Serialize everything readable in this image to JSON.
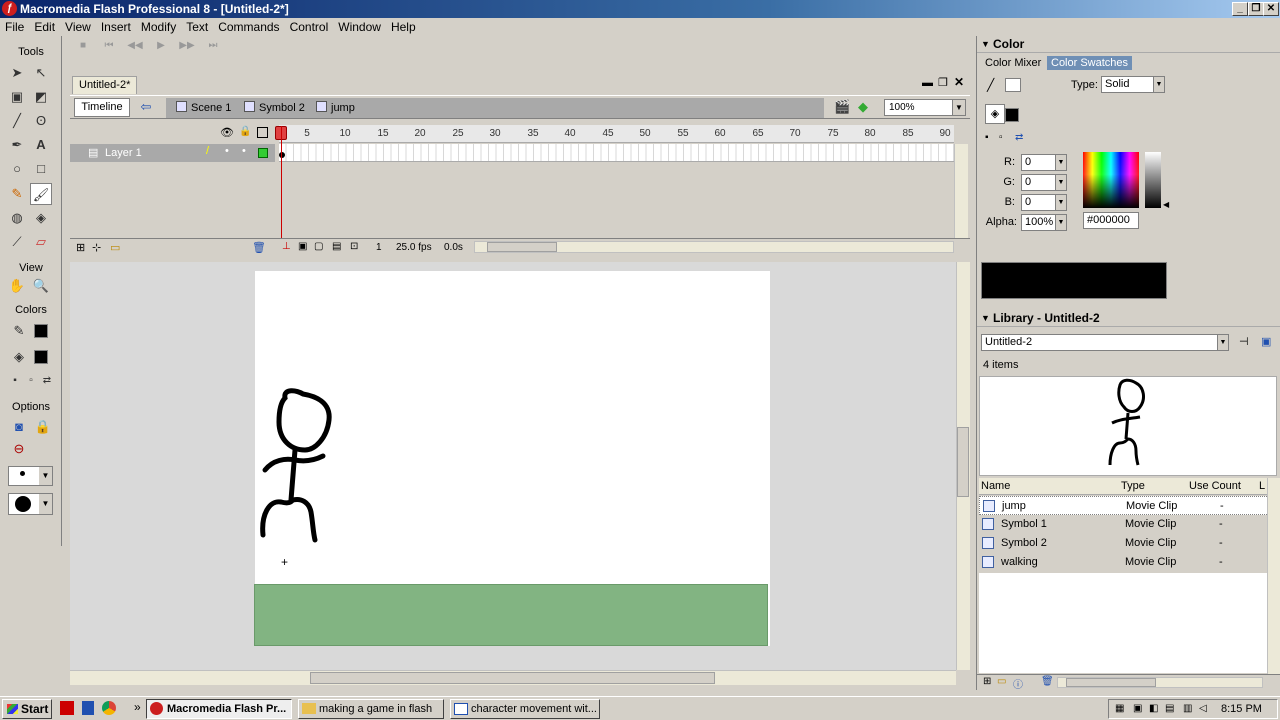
{
  "window": {
    "title": "Macromedia Flash Professional 8 - [Untitled-2*]"
  },
  "menu": [
    "File",
    "Edit",
    "View",
    "Insert",
    "Modify",
    "Text",
    "Commands",
    "Control",
    "Window",
    "Help"
  ],
  "tools": {
    "title": "Tools",
    "view_label": "View",
    "colors_label": "Colors",
    "options_label": "Options"
  },
  "document": {
    "tab": "Untitled-2*",
    "timeline_button": "Timeline",
    "breadcrumbs": [
      "Scene 1",
      "Symbol 2",
      "jump"
    ],
    "zoom": "100%"
  },
  "timeline": {
    "layer_name": "Layer 1",
    "ruler": [
      "5",
      "10",
      "15",
      "20",
      "25",
      "30",
      "35",
      "40",
      "45",
      "50",
      "55",
      "60",
      "65",
      "70",
      "75",
      "80",
      "85",
      "90"
    ],
    "current_frame": "1",
    "frame_rate": "25.0 fps",
    "elapsed": "0.0s"
  },
  "color_panel": {
    "title": "Color",
    "tab_mixer": "Color Mixer",
    "tab_swatches": "Color Swatches",
    "type_label": "Type:",
    "type_value": "Solid",
    "r_label": "R:",
    "r_value": "0",
    "g_label": "G:",
    "g_value": "0",
    "b_label": "B:",
    "b_value": "0",
    "alpha_label": "Alpha:",
    "alpha_value": "100%",
    "hex": "#000000",
    "preview_color": "#000000"
  },
  "library": {
    "title": "Library - Untitled-2",
    "document": "Untitled-2",
    "count": "4 items",
    "columns": [
      "Name",
      "Type",
      "Use Count",
      "L"
    ],
    "items": [
      {
        "name": "jump",
        "type": "Movie Clip",
        "use": "-"
      },
      {
        "name": "Symbol 1",
        "type": "Movie Clip",
        "use": "-"
      },
      {
        "name": "Symbol 2",
        "type": "Movie Clip",
        "use": "-"
      },
      {
        "name": "walking",
        "type": "Movie Clip",
        "use": "-"
      }
    ]
  },
  "taskbar": {
    "start": "Start",
    "buttons": [
      "Macromedia Flash Pr...",
      "making a game in flash",
      "character movement wit..."
    ],
    "clock": "8:15 PM"
  },
  "colors": {
    "ground": "#82b482",
    "stage": "#ffffff",
    "titlebar": "#0a246a"
  }
}
